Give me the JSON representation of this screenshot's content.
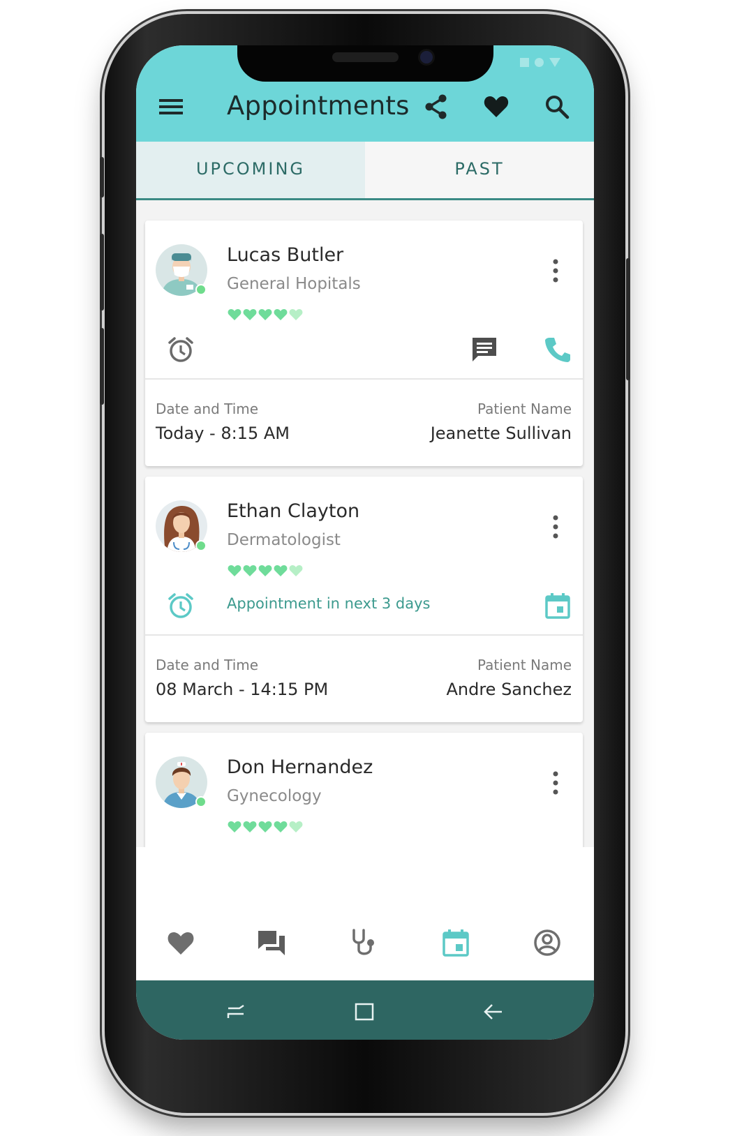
{
  "app": {
    "title": "Appointments"
  },
  "header_icons": [
    "menu-icon",
    "share-icon",
    "heart-icon",
    "search-icon"
  ],
  "tabs": [
    {
      "label": "UPCOMING",
      "active": true
    },
    {
      "label": "PAST",
      "active": false
    }
  ],
  "colors": {
    "appbar": "#6dd6d8",
    "accent": "#3c9a8e",
    "heart_full": "#6fdc9a",
    "heart_faded": "#b6efc6",
    "system_bar": "#2e6662"
  },
  "appointments": [
    {
      "doctor": "Lucas Butler",
      "specialty": "General Hopitals",
      "rating": 4.5,
      "reminder_text": "",
      "date_label": "Date and Time",
      "date_value": "Today - 8:15 AM",
      "patient_label": "Patient Name",
      "patient_value": "Jeanette Sullivan"
    },
    {
      "doctor": "Ethan Clayton",
      "specialty": "Dermatologist",
      "rating": 4.5,
      "reminder_text": "Appointment in next 3 days",
      "date_label": "Date and Time",
      "date_value": "08 March - 14:15 PM",
      "patient_label": "Patient Name",
      "patient_value": "Andre Sanchez"
    },
    {
      "doctor": "Don Hernandez",
      "specialty": "Gynecology",
      "rating": 4.5
    }
  ],
  "bottom_nav": [
    {
      "icon": "heart-icon",
      "active": false
    },
    {
      "icon": "chat-icon",
      "active": false
    },
    {
      "icon": "stethoscope-icon",
      "active": false
    },
    {
      "icon": "calendar-icon",
      "active": true
    },
    {
      "icon": "profile-icon",
      "active": false
    }
  ],
  "system_nav": [
    "recents-icon",
    "home-icon",
    "back-icon"
  ]
}
